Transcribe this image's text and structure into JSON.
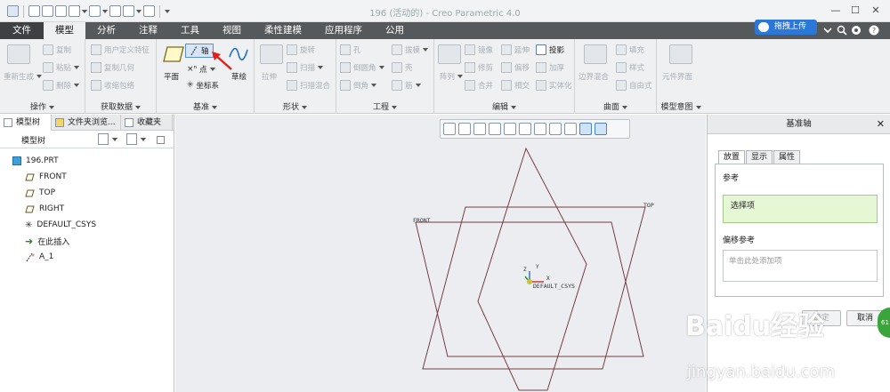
{
  "window": {
    "title": "196 (活动的) - Creo Parametric 4.0",
    "upload_label": "拖拽上传"
  },
  "tabs": [
    {
      "label": "文件"
    },
    {
      "label": "模型"
    },
    {
      "label": "分析"
    },
    {
      "label": "注释"
    },
    {
      "label": "工具"
    },
    {
      "label": "视图"
    },
    {
      "label": "柔性建模"
    },
    {
      "label": "应用程序"
    },
    {
      "label": "公用"
    }
  ],
  "ribbon": {
    "operations": {
      "label": "操作",
      "regen": "重新生成",
      "copy": "复制",
      "paste": "粘贴",
      "delete": "删除"
    },
    "get_data": {
      "label": "获取数据",
      "udf": "用户定义特征",
      "copy_geom": "复制几何",
      "shrinkwrap": "收缩包络"
    },
    "datum": {
      "label": "基准",
      "plane": "平面",
      "axis": "轴",
      "point": "点",
      "csys": "坐标系",
      "sketch": "草绘"
    },
    "shapes": {
      "label": "形状",
      "extrude": "拉伸",
      "revolve": "旋转",
      "sweep": "扫描",
      "swept_blend": "扫描混合"
    },
    "engineering": {
      "label": "工程",
      "hole": "孔",
      "round": "倒圆角",
      "chamfer": "倒角",
      "draft": "拔模",
      "shell": "壳",
      "rib": "筋"
    },
    "editing": {
      "label": "编辑",
      "pattern": "阵列",
      "mirror": "镜像",
      "extend": "延伸",
      "project": "投影",
      "trim": "修剪",
      "offset": "偏移",
      "thicken": "加厚",
      "merge": "合并",
      "intersect": "相交",
      "solidify": "实体化"
    },
    "surfaces": {
      "label": "曲面",
      "boundary_blend": "边界混合",
      "fill": "填充",
      "style": "样式",
      "freestyle": "自由式"
    },
    "intent": {
      "label": "模型意图",
      "component_interface": "元件界面"
    }
  },
  "left_panel": {
    "tabs": [
      {
        "label": "模型树"
      },
      {
        "label": "文件夹浏览..."
      },
      {
        "label": "收藏夹"
      }
    ],
    "tree_header": "模型树",
    "items": [
      {
        "label": "196.PRT"
      },
      {
        "label": "FRONT"
      },
      {
        "label": "TOP"
      },
      {
        "label": "RIGHT"
      },
      {
        "label": "DEFAULT_CSYS"
      },
      {
        "label": "在此插入"
      },
      {
        "label": "A_1"
      }
    ]
  },
  "canvas": {
    "label_front": "FRONT",
    "label_top": "TOP",
    "label_csys": "DEFAULT_CSYS",
    "axis_x": "X",
    "axis_y": "Y",
    "axis_z": "Z"
  },
  "dialog": {
    "title": "基准轴",
    "tabs": [
      {
        "label": "放置"
      },
      {
        "label": "显示"
      },
      {
        "label": "属性"
      }
    ],
    "ref_section": "参考",
    "ref_item": "选择项",
    "offset_section": "偏移参考",
    "offset_placeholder": "单击此处添加项",
    "ok": "确定",
    "cancel": "取消"
  },
  "watermark": {
    "text": "Baidu经验",
    "url": "jingyan.baidu.com"
  },
  "badge": {
    "text": "61"
  }
}
